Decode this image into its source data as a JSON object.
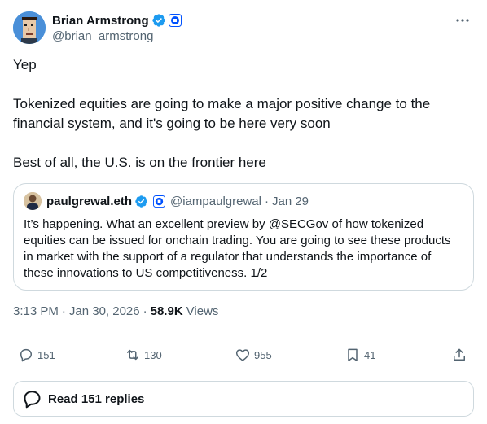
{
  "author": {
    "display_name": "Brian Armstrong",
    "handle": "@brian_armstrong",
    "avatar_icon": "pixel-punk-avatar",
    "verified_icon": "verified-badge-icon",
    "affiliation_icon": "coinbase-affiliate-icon"
  },
  "tweet": {
    "paragraphs": [
      "Yep",
      "Tokenized equities are going to make a major positive change to the financial system, and it's going to be here very soon",
      "Best of all, the U.S. is on the frontier here"
    ]
  },
  "quote": {
    "display_name": "paulgrewal.eth",
    "handle": "@iampaulgrewal",
    "date": "Jan 29",
    "text": "It’s happening. What an excellent preview by @SECGov of how tokenized equities can be issued for onchain trading. You are going to see these products in market with the support of a regulator that understands the importance of these innovations to US competitiveness. 1/2"
  },
  "meta": {
    "time": "3:13 PM",
    "date": "Jan 30, 2026",
    "views": "58.9K",
    "views_label": "Views"
  },
  "actions": {
    "replies": "151",
    "reposts": "130",
    "likes": "955",
    "bookmarks": "41"
  },
  "read_replies": "Read 151 replies",
  "colors": {
    "verified_blue": "#1d9bf0",
    "coinbase_blue": "#0052ff",
    "text": "#0f1419",
    "secondary": "#536471",
    "border": "#cfd9de"
  }
}
